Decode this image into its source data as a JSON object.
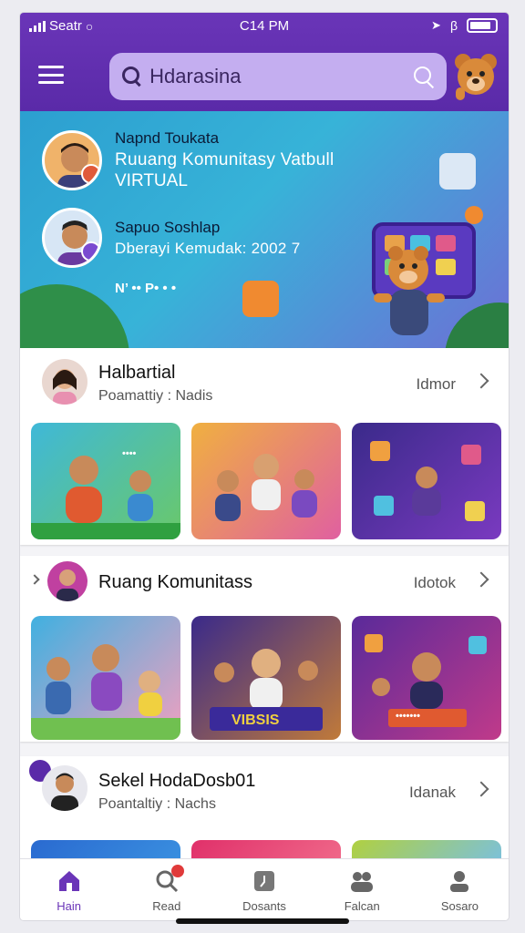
{
  "status_bar": {
    "carrier": "Seatr",
    "time": "C14 PM"
  },
  "search": {
    "value": "Hdarasina"
  },
  "hero": {
    "items": [
      {
        "name": "Napnd Toukata",
        "title": "Ruuang Komunitasy Vatbull",
        "subtitle": "VIRTUAL"
      },
      {
        "name": "Sapuo Soshlap",
        "title": "Dberayi Kemudak: 2002 7"
      }
    ],
    "small_text": "N’ •• P• • •"
  },
  "sections": [
    {
      "title": "Halbartial",
      "subtitle": "Poamattiy : Nadis",
      "more": "Idmor"
    },
    {
      "title": "Ruang Komunitass",
      "more": "Idotok"
    },
    {
      "title": "Sekel HodaDosb01",
      "subtitle": "Poantaltiy : Nachs",
      "more": "Idanak"
    }
  ],
  "card_texts": {
    "s1c1": "••••",
    "s2c2": "VIBSIS",
    "s2c3": "•••••••"
  },
  "bottom_nav": [
    {
      "label": "Hain"
    },
    {
      "label": "Read"
    },
    {
      "label": "Dosants"
    },
    {
      "label": "Falcan"
    },
    {
      "label": "Sosaro"
    }
  ],
  "colors": {
    "brand_purple": "#6a35b8",
    "search_bg": "#c4aef0",
    "hero_blue": "#2c9fd0"
  },
  "icons": {
    "menu": "menu-icon",
    "search": "search-icon",
    "chevron": "chevron-right-icon",
    "home": "home-icon",
    "read": "search-person-icon",
    "documents": "document-icon",
    "people": "people-icon",
    "profile": "profile-icon"
  }
}
